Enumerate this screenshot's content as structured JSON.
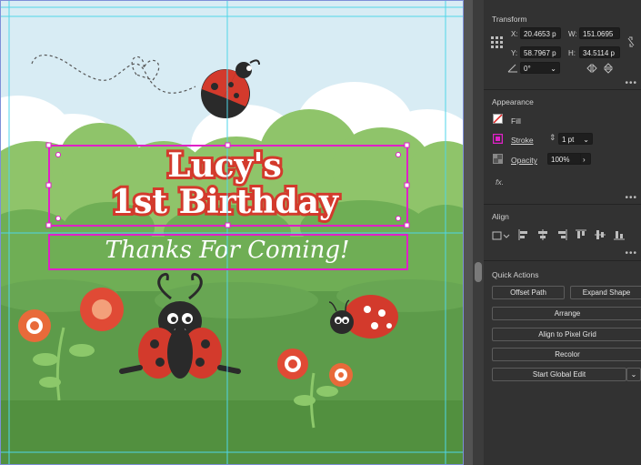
{
  "artwork": {
    "title_line1": "Lucy's",
    "title_line2": "1st Birthday",
    "subtitle": "Thanks For Coming!"
  },
  "panel": {
    "transform": {
      "title": "Transform",
      "x_label": "X:",
      "x_value": "20.4653 p",
      "y_label": "Y:",
      "y_value": "58.7967 p",
      "w_label": "W:",
      "w_value": "151.0695",
      "h_label": "H:",
      "h_value": "34.5114 p",
      "rotate_value": "0°"
    },
    "appearance": {
      "title": "Appearance",
      "fill_label": "Fill",
      "stroke_label": "Stroke",
      "stroke_value": "1 pt",
      "opacity_label": "Opacity",
      "opacity_value": "100%",
      "fx_label": "fx."
    },
    "align": {
      "title": "Align"
    },
    "quick_actions": {
      "title": "Quick Actions",
      "offset_path": "Offset Path",
      "expand_shape": "Expand Shape",
      "arrange": "Arrange",
      "align_pixel": "Align to Pixel Grid",
      "recolor": "Recolor",
      "global_edit": "Start Global Edit"
    },
    "more_glyph": "•••"
  },
  "colors": {
    "sky": "#d8ecf4",
    "grass_dark": "#5d9b4a",
    "grass_light": "#8fc46a",
    "ladybug_red": "#d33a2c",
    "selection_magenta": "#e020c8",
    "guide_cyan": "#4fd6e8",
    "panel_bg": "#323232"
  }
}
